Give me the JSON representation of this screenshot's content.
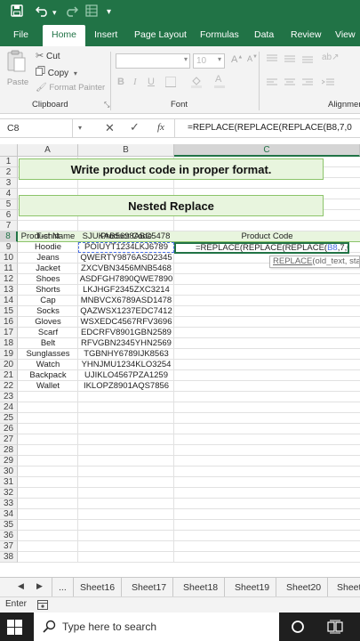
{
  "titlebar": {
    "quick_access_dropdown": "▾"
  },
  "menu": {
    "tabs": [
      {
        "label": "File"
      },
      {
        "label": "Home"
      },
      {
        "label": "Insert"
      },
      {
        "label": "Page Layout"
      },
      {
        "label": "Formulas"
      },
      {
        "label": "Data"
      },
      {
        "label": "Review"
      },
      {
        "label": "View"
      }
    ],
    "active_index": 1
  },
  "ribbon": {
    "clipboard": {
      "paste": "Paste",
      "cut": "Cut",
      "copy": "Copy",
      "format_painter": "Format Painter",
      "group_label": "Clipboard"
    },
    "font": {
      "size": "10",
      "bold": "B",
      "italic": "I",
      "underline": "U",
      "group_label": "Font"
    },
    "alignment": {
      "group_label": "Alignmen"
    }
  },
  "formula_bar": {
    "name_box": "C8",
    "fx": "fx",
    "formula": "=REPLACE(REPLACE(REPLACE(B8,7,0"
  },
  "grid": {
    "columns": [
      "A",
      "B",
      "C"
    ],
    "row_numbers": [
      "1",
      "2",
      "3",
      "4",
      "5",
      "6",
      "7",
      "8",
      "9",
      "10",
      "11",
      "12",
      "13",
      "14",
      "15",
      "16",
      "17",
      "18",
      "19",
      "20",
      "21",
      "22",
      "23",
      "24",
      "25",
      "26",
      "27",
      "28",
      "29",
      "30",
      "31",
      "32",
      "33",
      "34",
      "35",
      "36",
      "37",
      "38"
    ],
    "title1": "Write product code in proper format.",
    "title2": "Nested Replace",
    "headers": [
      "Product Name",
      "Product Code",
      "Product Code"
    ],
    "rows": [
      [
        "T-shirt",
        "SJUKAB5698ABC5478"
      ],
      [
        "Hoodie",
        "POIUYT1234LKJ6789"
      ],
      [
        "Jeans",
        "QWERTY9876ASD2345"
      ],
      [
        "Jacket",
        "ZXCVBN3456MNB5468"
      ],
      [
        "Shoes",
        "ASDFGH7890QWE7890"
      ],
      [
        "Shorts",
        "LKJHGF2345ZXC3214"
      ],
      [
        "Cap",
        "MNBVCX6789ASD1478"
      ],
      [
        "Socks",
        "QAZWSX1237EDC7412"
      ],
      [
        "Gloves",
        "WSXEDC4567RFV3696"
      ],
      [
        "Scarf",
        "EDCRFV8901GBN2589"
      ],
      [
        "Belt",
        "RFVGBN2345YHN2569"
      ],
      [
        "Sunglasses",
        "TGBNHY6789IJK8563"
      ],
      [
        "Watch",
        "YHNJMU1234KLO3254"
      ],
      [
        "Backpack",
        "UJIKLO4567PZA1259"
      ],
      [
        "Wallet",
        "IKLOPZ8901AQS7856"
      ]
    ],
    "editing": {
      "prefix": "=REPLACE(REPLACE(REPLACE(",
      "ref": "B8",
      "suffix": ",7,0"
    },
    "tooltip": {
      "func": "REPLACE",
      "args": "(old_text, start"
    }
  },
  "sheets": {
    "ellipsis": "...",
    "tabs": [
      "Sheet16",
      "Sheet17",
      "Sheet18",
      "Sheet19",
      "Sheet20",
      "Sheet"
    ]
  },
  "status": {
    "mode": "Enter"
  },
  "taskbar": {
    "search_placeholder": "Type here to search"
  },
  "colors": {
    "excel_green": "#217346",
    "ref_blue": "#4a6fe3",
    "header_fill": "#e8f5de",
    "header_border": "#8cc46a"
  }
}
